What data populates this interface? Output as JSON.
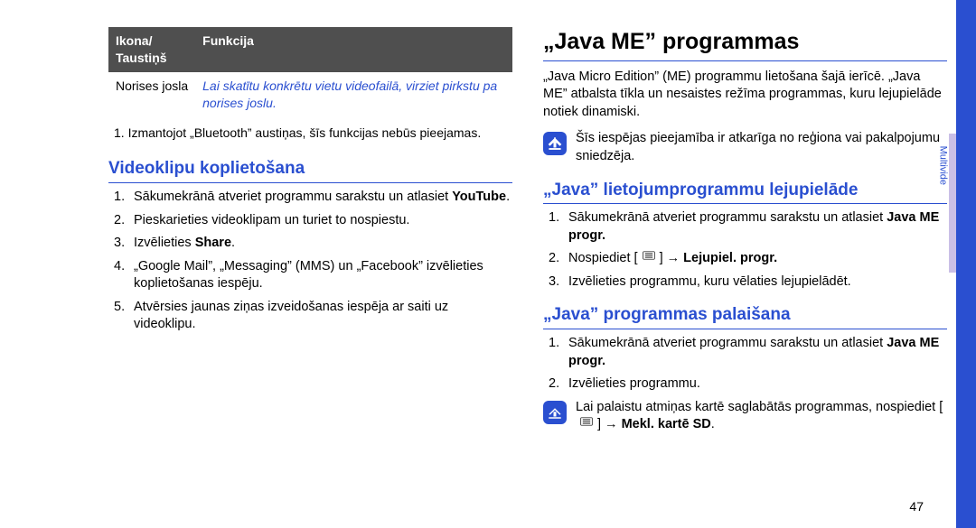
{
  "page_number": "47",
  "sidebar_label": "Multivide",
  "left": {
    "table": {
      "header1": "Ikona/\nTaustiņš",
      "header2": "Funkcija",
      "row": {
        "c1": "Norises josla",
        "c2": "Lai skatītu konkrētu vietu videofailā, virziet pirkstu pa norises joslu."
      }
    },
    "footnote": "1. Izmantojot „Bluetooth” austiņas, šīs funkcijas nebūs pieejamas.",
    "section_title": "Videoklipu koplietošana",
    "steps": [
      {
        "pre": "Sākumekrānā atveriet programmu sarakstu un atlasiet ",
        "bold": "YouTube",
        "post": "."
      },
      {
        "pre": "Pieskarieties videoklipam un turiet to nospiestu."
      },
      {
        "pre": "Izvēlieties ",
        "bold": "Share",
        "post": "."
      },
      {
        "pre": "„Google Mail”, „Messaging” (MMS) un „Facebook” izvēlieties koplietošanas iespēju."
      },
      {
        "pre": "Atvērsies jaunas ziņas izveidošanas iespēja ar saiti uz videoklipu."
      }
    ]
  },
  "right": {
    "heading": "„Java ME” programmas",
    "intro": "„Java Micro Edition” (ME) programmu lietošana šajā ierīcē. „Java ME” atbalsta tīkla un nesaistes režīma programmas, kuru lejupielāde notiek dinamiski.",
    "tip1": "Šīs iespējas pieejamība ir atkarīga no reģiona vai pakalpojumu sniedzēja.",
    "section1_title": "„Java” lietojumprogrammu lejupielāde",
    "section1_steps": [
      {
        "pre": "Sākumekrānā atveriet programmu sarakstu un atlasiet ",
        "bold": "Java ME progr."
      },
      {
        "pre": "Nospiediet [",
        "key": true,
        "mid": "] → ",
        "bold": "Lejupiel. progr."
      },
      {
        "pre": "Izvēlieties programmu, kuru vēlaties lejupielādēt."
      }
    ],
    "section2_title": "„Java” programmas palaišana",
    "section2_steps": [
      {
        "pre": "Sākumekrānā atveriet programmu sarakstu un atlasiet ",
        "bold": "Java ME progr."
      },
      {
        "pre": "Izvēlieties programmu."
      }
    ],
    "tip2_pre": "Lai palaistu atmiņas kartē saglabātās programmas, nospiediet [",
    "tip2_mid": "] → ",
    "tip2_bold": "Mekl. kartē SD",
    "tip2_post": "."
  }
}
